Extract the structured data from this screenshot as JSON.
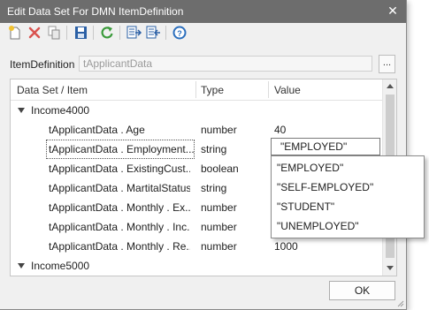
{
  "window": {
    "title": "Edit Data Set For DMN ItemDefinition",
    "close_glyph": "✕"
  },
  "toolbar": {
    "buttons": [
      {
        "icon": "new-item-icon",
        "color": "#e8b84a"
      },
      {
        "icon": "delete-icon",
        "color": "#d9534f"
      },
      {
        "icon": "copy-icon",
        "color": "#8a8a8a"
      },
      {
        "icon": "save-icon",
        "color": "#2a5fa5"
      },
      {
        "icon": "refresh-icon",
        "color": "#3a9a3a"
      },
      {
        "icon": "import-icon",
        "color": "#2a5fa5"
      },
      {
        "icon": "export-icon",
        "color": "#2a5fa5"
      },
      {
        "icon": "help-icon",
        "color": "#2a6ebd"
      }
    ]
  },
  "item_definition": {
    "label": "ItemDefinition",
    "value": "tApplicantData",
    "browse_label": "..."
  },
  "grid": {
    "columns": [
      "Data Set / Item",
      "Type",
      "Value"
    ],
    "rows": [
      {
        "kind": "group",
        "item": "Income4000",
        "type": "",
        "value": ""
      },
      {
        "kind": "item",
        "item": "tApplicantData . Age",
        "type": "number",
        "value": "40"
      },
      {
        "kind": "item",
        "item": "tApplicantData . Employment...",
        "type": "string",
        "value": "\"EMPLOYED\""
      },
      {
        "kind": "item",
        "item": "tApplicantData . ExistingCust...",
        "type": "boolean",
        "value": ""
      },
      {
        "kind": "item",
        "item": "tApplicantData . MartitalStatus",
        "type": "string",
        "value": ""
      },
      {
        "kind": "item",
        "item": "tApplicantData . Monthly . Ex...",
        "type": "number",
        "value": ""
      },
      {
        "kind": "item",
        "item": "tApplicantData . Monthly . Inc...",
        "type": "number",
        "value": ""
      },
      {
        "kind": "item",
        "item": "tApplicantData . Monthly . Re...",
        "type": "number",
        "value": "1000"
      },
      {
        "kind": "group",
        "item": "Income5000",
        "type": "",
        "value": ""
      }
    ]
  },
  "editor": {
    "value": "\"EMPLOYED\"",
    "options": [
      "\"EMPLOYED\"",
      "\"SELF-EMPLOYED\"",
      "\"STUDENT\"",
      "\"UNEMPLOYED\""
    ]
  },
  "footer": {
    "ok_label": "OK"
  }
}
